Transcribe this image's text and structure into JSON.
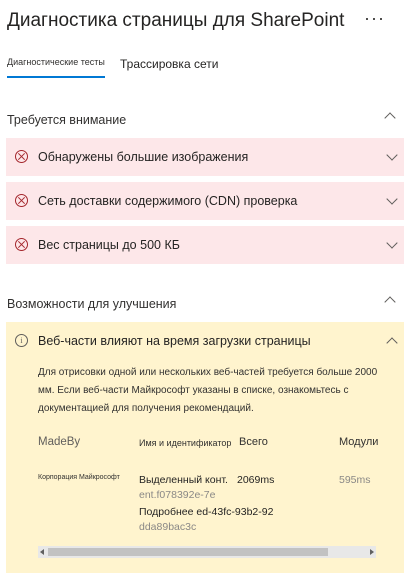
{
  "panel": {
    "title": "Диагностика страницы для SharePoint",
    "more_label": "···"
  },
  "tabs": [
    {
      "label": "Диагностические тесты",
      "active": true
    },
    {
      "label": "Трассировка сети",
      "active": false
    }
  ],
  "attention": {
    "heading": "Требуется внимание",
    "items": [
      {
        "label": "Обнаружены большие изображения",
        "icon": "error-circle-icon"
      },
      {
        "label": "Сеть доставки содержимого (CDN) проверка",
        "icon": "error-circle-icon"
      },
      {
        "label": "Вес страницы до 500 КБ",
        "icon": "error-circle-icon"
      }
    ]
  },
  "improvements": {
    "heading": "Возможности для улучшения",
    "item": {
      "title": "Веб-части влияют на время загрузки страницы",
      "icon": "info-icon",
      "description": "Для отрисовки одной или нескольких веб-частей требуется больше 2000 мм. Если веб-части Майкрософт указаны в списке, ознакомьтесь с документацией для получения рекомендаций.",
      "table": {
        "columns": [
          "MadeBy",
          "Имя и идентификатор",
          "Всего",
          "Модули"
        ],
        "rows": [
          {
            "made_by": "Корпорация Майкрософт",
            "name_line1": "Выделенный конт.",
            "total": "2069ms",
            "id_line1": "ent.f078392e-7e",
            "name_line2": "Подробнее ed-43fc-93b2-92",
            "id_line2": "dda89bac3c",
            "modules": "595ms"
          }
        ]
      }
    }
  },
  "colors": {
    "error_bg": "#fde7e9",
    "warning_bg": "#fff4ce",
    "accent": "#0078d4",
    "error_icon": "#a4262c"
  }
}
